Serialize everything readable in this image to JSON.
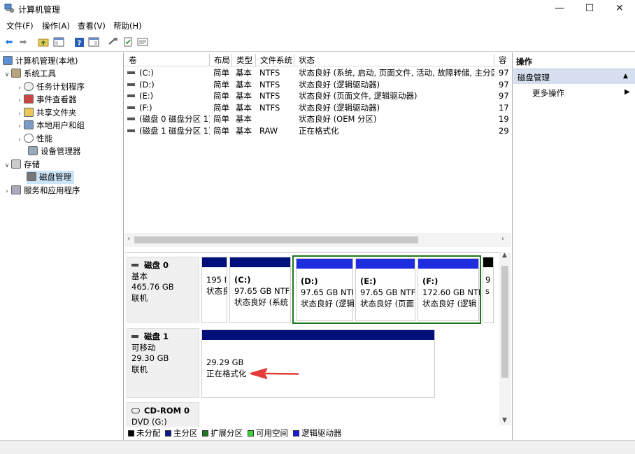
{
  "window": {
    "title": "计算机管理",
    "minimize": "—",
    "maximize": "☐",
    "close": "✕"
  },
  "menu": [
    "文件(F)",
    "操作(A)",
    "查看(V)",
    "帮助(H)"
  ],
  "tree": {
    "root": "计算机管理(本地)",
    "system_tools": "系统工具",
    "task_scheduler": "任务计划程序",
    "event_viewer": "事件查看器",
    "shared_folders": "共享文件夹",
    "local_users": "本地用户和组",
    "performance": "性能",
    "device_manager": "设备管理器",
    "storage": "存储",
    "disk_management": "磁盘管理",
    "services_apps": "服务和应用程序"
  },
  "volume_table": {
    "headers": [
      "卷",
      "布局",
      "类型",
      "文件系统",
      "状态",
      "容"
    ],
    "rows": [
      {
        "name": "(C:)",
        "layout": "简单",
        "type": "基本",
        "fs": "NTFS",
        "status": "状态良好 (系统, 启动, 页面文件, 活动, 故障转储, 主分区)",
        "cap": "97"
      },
      {
        "name": "(D:)",
        "layout": "简单",
        "type": "基本",
        "fs": "NTFS",
        "status": "状态良好 (逻辑驱动器)",
        "cap": "97"
      },
      {
        "name": "(E:)",
        "layout": "简单",
        "type": "基本",
        "fs": "NTFS",
        "status": "状态良好 (页面文件, 逻辑驱动器)",
        "cap": "97"
      },
      {
        "name": "(F:)",
        "layout": "简单",
        "type": "基本",
        "fs": "NTFS",
        "status": "状态良好 (逻辑驱动器)",
        "cap": "17"
      },
      {
        "name": "(磁盘 0 磁盘分区 1)",
        "layout": "简单",
        "type": "基本",
        "fs": "",
        "status": "状态良好 (OEM 分区)",
        "cap": "19"
      },
      {
        "name": "(磁盘 1 磁盘分区 1)",
        "layout": "简单",
        "type": "基本",
        "fs": "RAW",
        "status": "正在格式化",
        "cap": "29"
      }
    ]
  },
  "disks": {
    "disk0": {
      "name": "磁盘 0",
      "kind": "基本",
      "size": "465.76 GB",
      "state": "联机",
      "p0_line1": "195 I",
      "p0_line2": "状态良",
      "pc_label": "(C:)",
      "pc_size": "97.65 GB NTFS",
      "pc_status": "状态良好 (系统",
      "pd_label": "(D:)",
      "pd_size": "97.65 GB NTI",
      "pd_status": "状态良好 (逻辑",
      "pe_label": "(E:)",
      "pe_size": "97.65 GB NTFS",
      "pe_status": "状态良好 (页面",
      "pf_label": "(F:)",
      "pf_size": "172.60 GB NTI",
      "pf_status": "状态良好 (逻辑",
      "plast_line1": "9",
      "plast_line2": "s"
    },
    "disk1": {
      "name": "磁盘 1",
      "kind": "可移动",
      "size": "29.30 GB",
      "state": "联机",
      "p_size": "29.29 GB",
      "p_status": "正在格式化"
    },
    "cdrom": {
      "name": "CD-ROM 0",
      "drive": "DVD (G:)"
    }
  },
  "legend": [
    {
      "label": "未分配",
      "color": "#000000"
    },
    {
      "label": "主分区",
      "color": "#0a1a8c"
    },
    {
      "label": "扩展分区",
      "color": "#1f7a1f"
    },
    {
      "label": "可用空间",
      "color": "#3ad43a"
    },
    {
      "label": "逻辑驱动器",
      "color": "#1a1adf"
    }
  ],
  "actions": {
    "header": "操作",
    "section": "磁盘管理",
    "more": "更多操作"
  },
  "colors": {
    "primary_partition": "#000f7a",
    "logical_drive": "#1e2ddd",
    "extended_border": "#1f7a1f",
    "annotation_arrow": "#e53b3b"
  }
}
